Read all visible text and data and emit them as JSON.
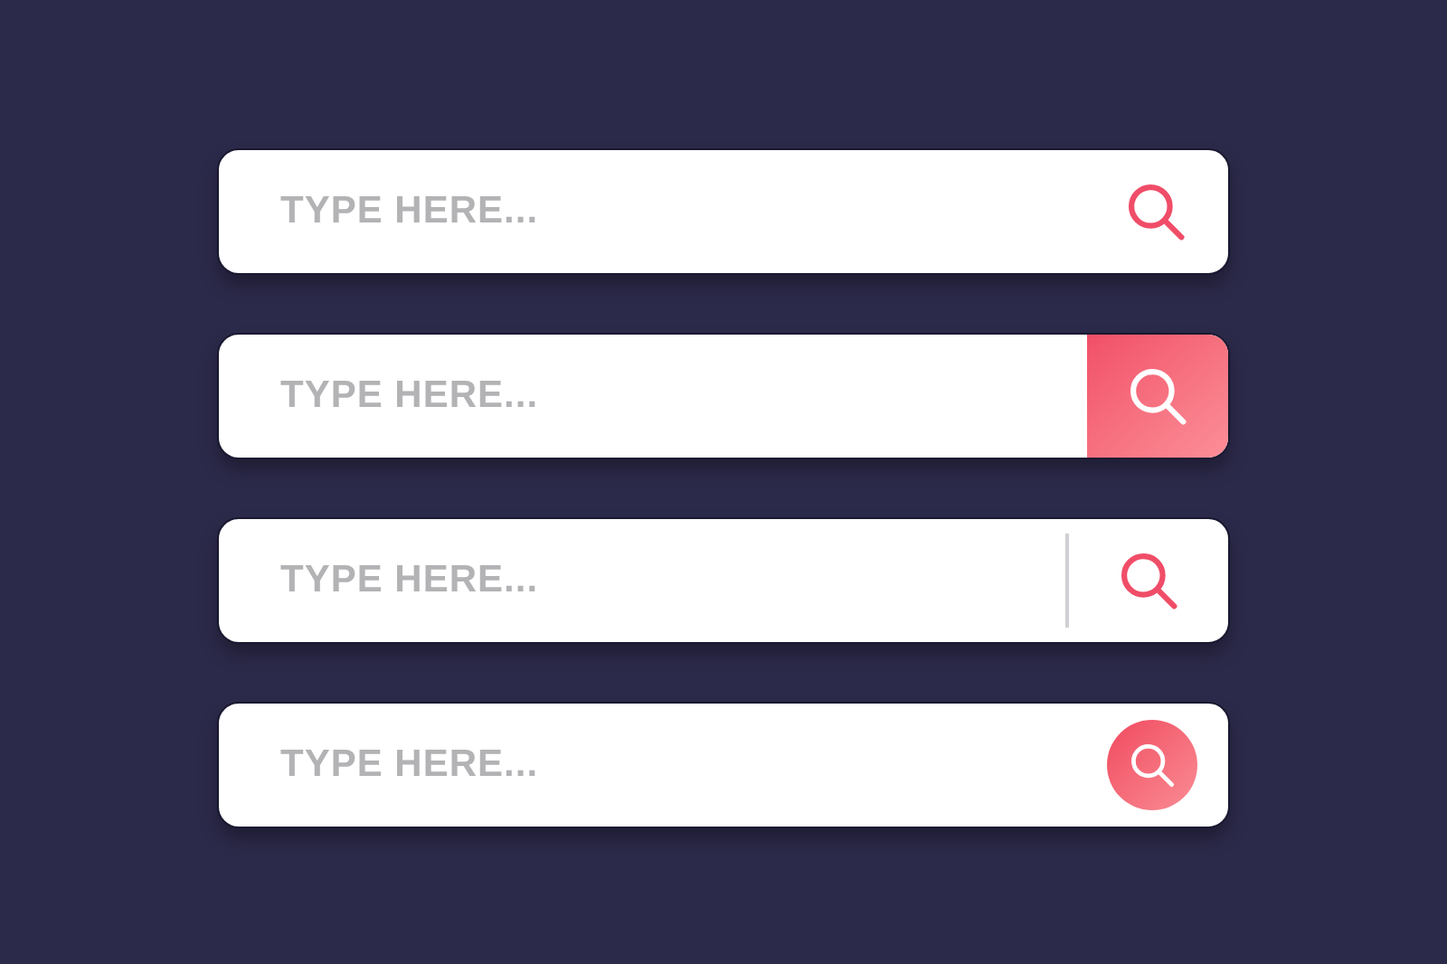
{
  "search_bars": [
    {
      "kind": "plain",
      "placeholder": "TYPE HERE..."
    },
    {
      "kind": "filled",
      "placeholder": "TYPE HERE..."
    },
    {
      "kind": "divider",
      "placeholder": "TYPE HERE..."
    },
    {
      "kind": "circle",
      "placeholder": "TYPE HERE..."
    }
  ]
}
